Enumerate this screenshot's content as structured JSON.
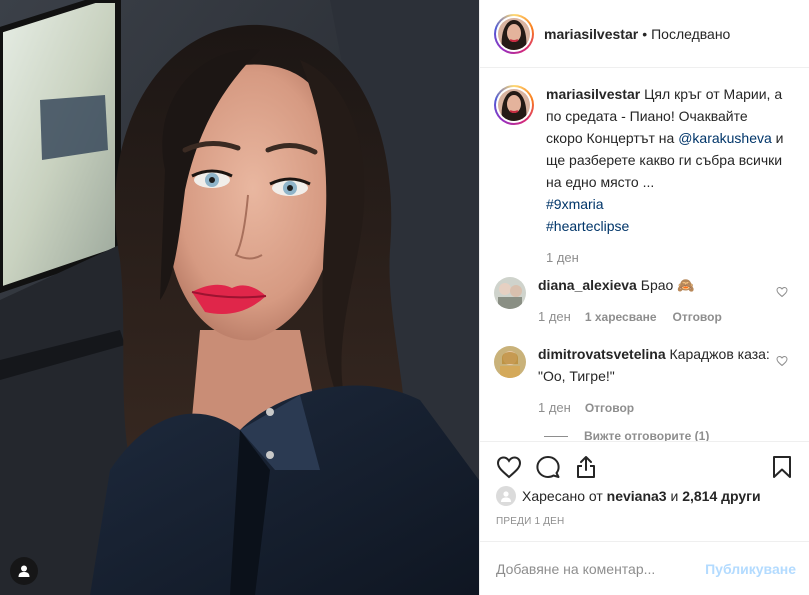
{
  "header": {
    "username": "mariasilvestar",
    "separator": "•",
    "follow_status": "Последвано"
  },
  "caption": {
    "username": "mariasilvestar",
    "text_before_mention": "Цял кръг от Марии, а по средата - Пиано! Очаквайте скоро Концертът на ",
    "mention": "@karakusheva",
    "text_after_mention": " и ще разберете какво ги събра всички на едно място ...",
    "hashtags": [
      "#9xmaria",
      "#hearteclipse"
    ],
    "time": "1 ден"
  },
  "comments": [
    {
      "username": "diana_alexieva",
      "text": "Брао 🙈",
      "time": "1 ден",
      "likes": "1 харесване",
      "reply": "Отговор"
    },
    {
      "username": "dimitrovatsvetelina",
      "text": "Караджов каза: \"Оо, Тигре!\"",
      "time": "1 ден",
      "reply": "Отговор",
      "view_replies": "Вижте отговорите (1)"
    }
  ],
  "likes": {
    "prefix": "Харесано от ",
    "user": "neviana3",
    "connector": " и ",
    "others": "2,814 други"
  },
  "timestamp": "ПРЕДИ 1 ДЕН",
  "add_comment": {
    "placeholder": "Добавяне на коментар...",
    "post_label": "Публикуване"
  },
  "colors": {
    "link": "#003569",
    "muted": "#8e8e8e",
    "post_disabled": "#b3dbff",
    "border": "#efefef"
  },
  "icons": [
    "user-tag-icon",
    "heart-icon",
    "comment-icon",
    "share-icon",
    "bookmark-icon"
  ]
}
